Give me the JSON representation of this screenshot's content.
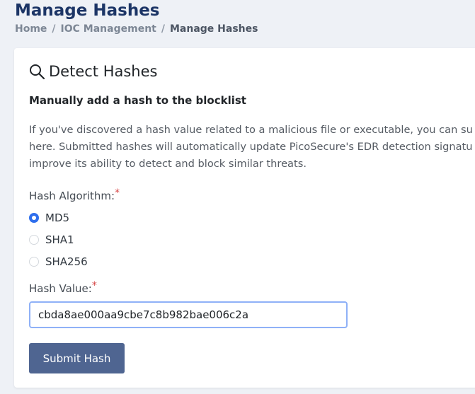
{
  "page": {
    "title": "Manage Hashes"
  },
  "breadcrumb": {
    "items": [
      "Home",
      "IOC Management",
      "Manage Hashes"
    ],
    "separator": "/"
  },
  "card": {
    "title": "Detect Hashes",
    "title_icon": "search-icon",
    "subheading": "Manually add a hash to the blocklist",
    "description_lines": [
      "If you've discovered a hash value related to a malicious file or executable, you can su",
      "here. Submitted hashes will automatically update PicoSecure's EDR detection signatu",
      "improve its ability to detect and block similar threats."
    ]
  },
  "form": {
    "algorithm_label": "Hash Algorithm:",
    "required_mark": "*",
    "algorithms": [
      {
        "label": "MD5",
        "checked": true
      },
      {
        "label": "SHA1",
        "checked": false
      },
      {
        "label": "SHA256",
        "checked": false
      }
    ],
    "hash_label": "Hash Value:",
    "hash_value": "cbda8ae000aa9cbe7c8b982bae006c2a",
    "submit_label": "Submit Hash"
  },
  "colors": {
    "title": "#1c3566",
    "accent": "#2f6fed",
    "button": "#4f6591",
    "required": "#d64545"
  }
}
